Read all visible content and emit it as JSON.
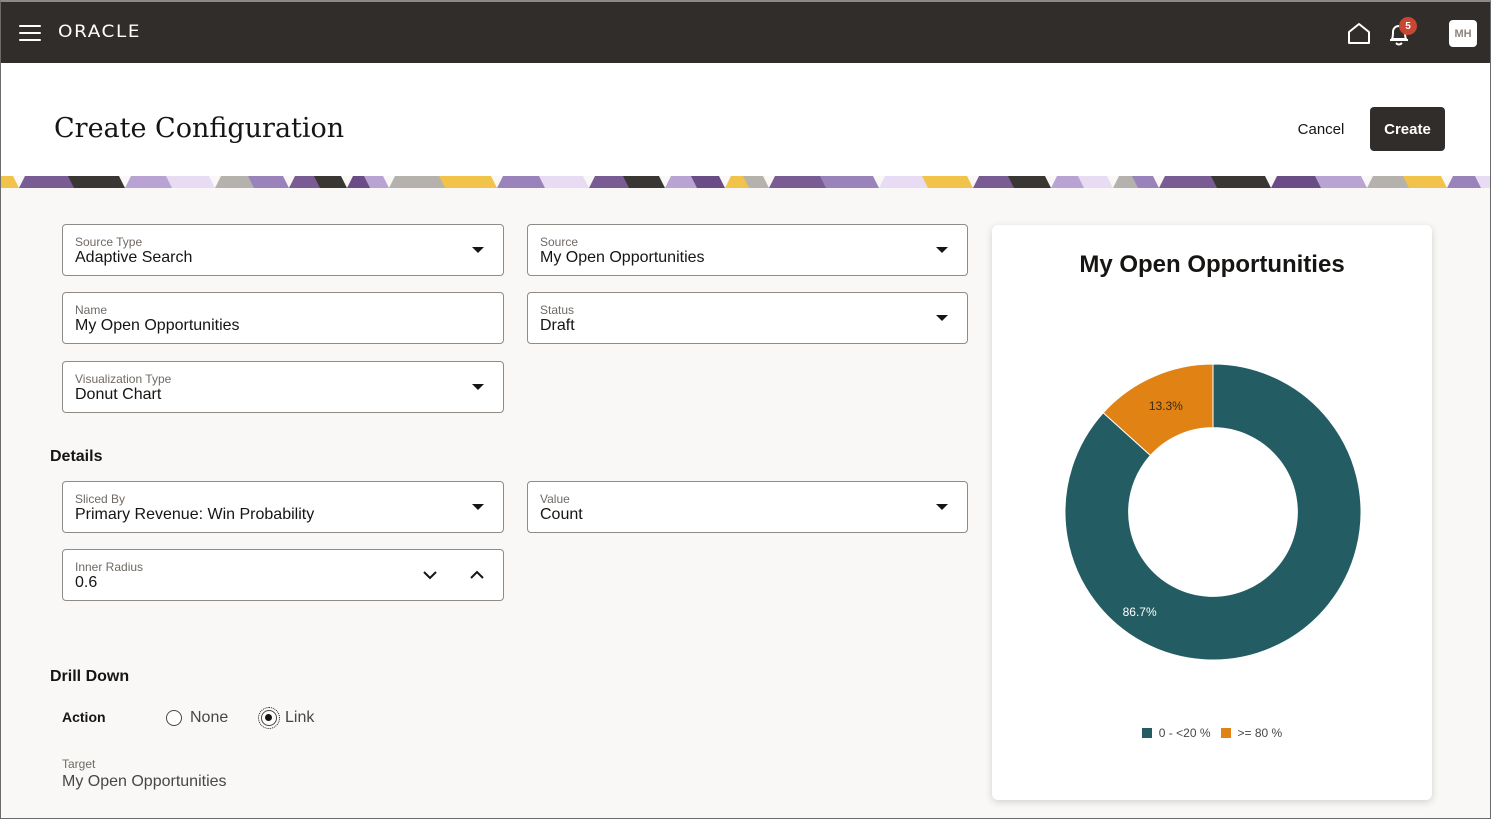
{
  "topbar": {
    "logo": "ORACLE",
    "icons": [
      "menu-icon",
      "home-icon",
      "bell-icon"
    ],
    "notification_count": "5",
    "avatar_initials": "MH"
  },
  "header": {
    "title": "Create Configuration",
    "cancel_label": "Cancel",
    "create_label": "Create"
  },
  "form": {
    "source_type": {
      "label": "Source Type",
      "value": "Adaptive Search"
    },
    "source": {
      "label": "Source",
      "value": "My Open Opportunities"
    },
    "name": {
      "label": "Name",
      "value": "My Open Opportunities"
    },
    "status": {
      "label": "Status",
      "value": "Draft"
    },
    "visualization_type": {
      "label": "Visualization Type",
      "value": "Donut Chart"
    }
  },
  "details": {
    "heading": "Details",
    "sliced_by": {
      "label": "Sliced By",
      "value": "Primary Revenue: Win Probability"
    },
    "value": {
      "label": "Value",
      "value": "Count"
    },
    "inner_radius": {
      "label": "Inner Radius",
      "value": "0.6"
    }
  },
  "drill_down": {
    "heading": "Drill Down",
    "action_label": "Action",
    "options": [
      {
        "label": "None",
        "selected": false
      },
      {
        "label": "Link",
        "selected": true
      }
    ],
    "target_label": "Target",
    "target_value": "My Open Opportunities"
  },
  "chart_data": {
    "type": "pie",
    "title": "My Open Opportunities",
    "inner_radius": 0.6,
    "categories": [
      "0 - <20 %",
      ">= 80 %"
    ],
    "values": [
      86.7,
      13.3
    ],
    "labels": [
      "86.7%",
      "13.3%"
    ],
    "colors": [
      "#235d63",
      "#e08214"
    ],
    "legend_position": "bottom"
  }
}
